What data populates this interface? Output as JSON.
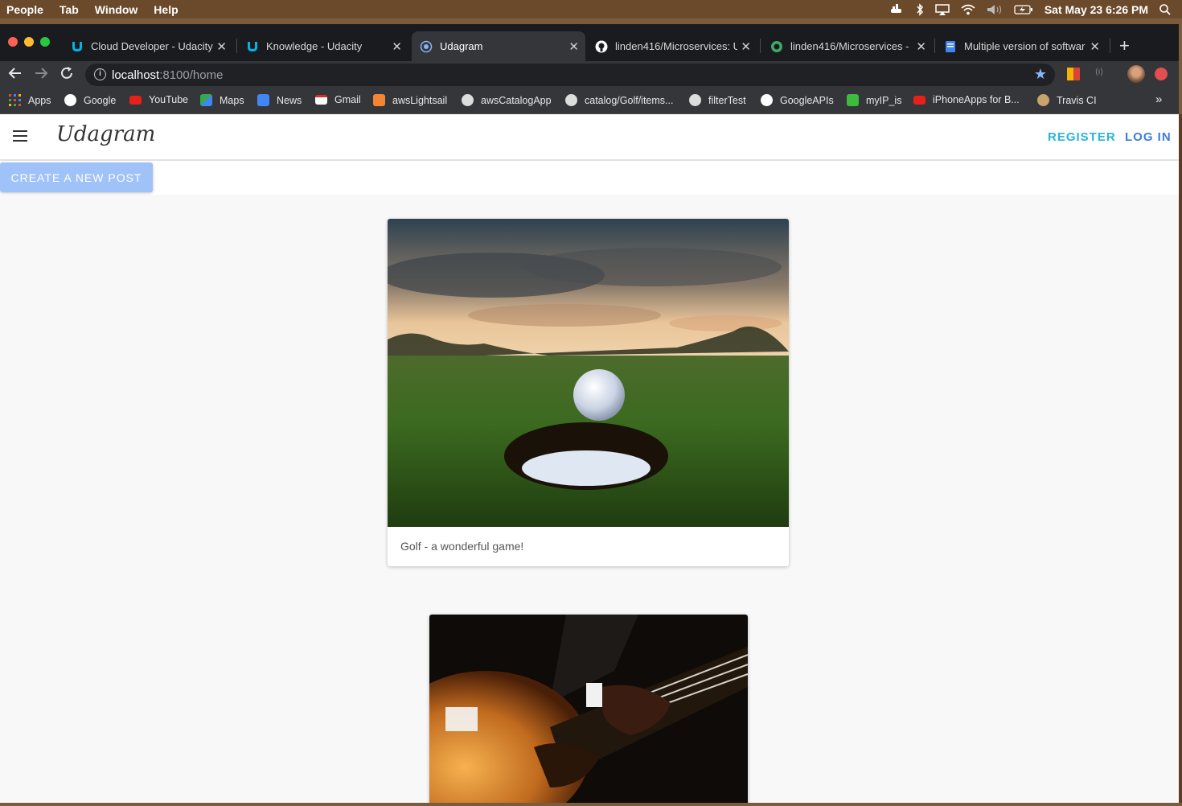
{
  "menubar": {
    "items": [
      "People",
      "Tab",
      "Window",
      "Help"
    ],
    "clock": "Sat May 23  6:26 PM"
  },
  "tabs": [
    {
      "label": "Cloud Developer - Udacity",
      "icon": "udacity-icon"
    },
    {
      "label": "Knowledge - Udacity",
      "icon": "udacity-icon"
    },
    {
      "label": "Udagram",
      "icon": "chrome-loading-icon"
    },
    {
      "label": "linden416/Microservices: U",
      "icon": "github-icon"
    },
    {
      "label": "linden416/Microservices -",
      "icon": "travis-icon"
    },
    {
      "label": "Multiple version of softwar",
      "icon": "doc-icon"
    }
  ],
  "address": {
    "host": "localhost",
    "rest": ":8100/home"
  },
  "bookmarks": [
    {
      "label": "Apps",
      "color": "#e04a3c"
    },
    {
      "label": "Google",
      "color": "#ffffff"
    },
    {
      "label": "YouTube",
      "color": "#e62117"
    },
    {
      "label": "Maps",
      "color": "#34a853"
    },
    {
      "label": "News",
      "color": "#4285f4"
    },
    {
      "label": "Gmail",
      "color": "#d93025"
    },
    {
      "label": "awsLightsail",
      "color": "#f58534"
    },
    {
      "label": "awsCatalogApp",
      "color": "#dddddd"
    },
    {
      "label": "catalog/Golf/items...",
      "color": "#dddddd"
    },
    {
      "label": "filterTest",
      "color": "#dddddd"
    },
    {
      "label": "GoogleAPIs",
      "color": "#ffffff"
    },
    {
      "label": "myIP_is",
      "color": "#3dbb3d"
    },
    {
      "label": "iPhoneApps for B...",
      "color": "#e62117"
    },
    {
      "label": "Travis CI",
      "color": "#c9a36b"
    }
  ],
  "bookmarks_overflow": "»",
  "app": {
    "brand": "Udagram",
    "register": "REGISTER",
    "login": "LOG IN",
    "create_post": "CREATE A NEW POST"
  },
  "feed": [
    {
      "caption": "Golf - a wonderful game!",
      "image": "golf-ball-at-hole"
    },
    {
      "caption": "",
      "image": "guitar-player"
    }
  ],
  "colors": {
    "accent_register": "#2bb4d7",
    "accent_login": "#3b7be0",
    "create_button": "#9fc2f8"
  }
}
